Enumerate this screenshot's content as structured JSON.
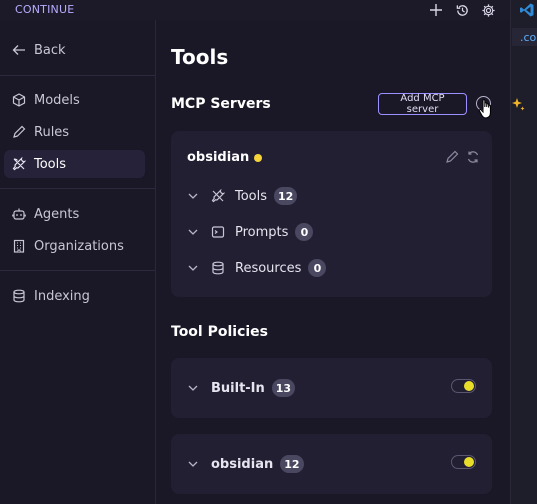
{
  "app": {
    "name": "CONTINUE"
  },
  "right_strip": {
    "tab_label": ".co"
  },
  "sidebar": {
    "back_label": "Back",
    "items": [
      {
        "label": "Models",
        "icon": "cube-icon"
      },
      {
        "label": "Rules",
        "icon": "pencil-icon"
      },
      {
        "label": "Tools",
        "icon": "tools-icon",
        "active": true
      },
      {
        "label": "Agents",
        "icon": "robot-icon"
      },
      {
        "label": "Organizations",
        "icon": "building-icon"
      },
      {
        "label": "Indexing",
        "icon": "database-icon"
      }
    ]
  },
  "main": {
    "title": "Tools",
    "mcp": {
      "heading": "MCP Servers",
      "add_button": "Add MCP server",
      "server": {
        "name": "obsidian",
        "status_color": "#f5d43a",
        "rows": [
          {
            "label": "Tools",
            "count": "12"
          },
          {
            "label": "Prompts",
            "count": "0"
          },
          {
            "label": "Resources",
            "count": "0"
          }
        ]
      }
    },
    "policies": {
      "heading": "Tool Policies",
      "items": [
        {
          "label": "Built-In",
          "count": "13",
          "enabled": true
        },
        {
          "label": "obsidian",
          "count": "12",
          "enabled": true
        }
      ]
    }
  },
  "colors": {
    "accent": "#9a90ff",
    "toggle_on": "#e8de2a",
    "background": "#1a1726",
    "card": "#231f33"
  }
}
